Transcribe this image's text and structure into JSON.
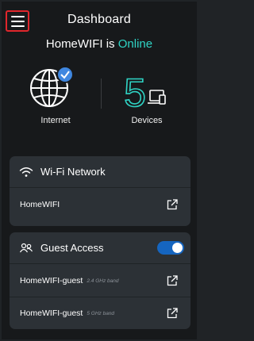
{
  "header": {
    "title": "Dashboard",
    "menu_icon": "hamburger-menu-icon"
  },
  "status": {
    "network_name": "HomeWIFI is",
    "state": "Online",
    "state_color": "#2fd4c5"
  },
  "internet": {
    "label": "Internet",
    "icon": "globe-icon",
    "badge_icon": "checkmark-badge-icon"
  },
  "devices": {
    "count": "5",
    "label": "Devices",
    "icon": "devices-icon"
  },
  "wifi_card": {
    "title": "Wi-Fi Network",
    "icon": "wifi-icon",
    "networks": [
      {
        "name": "HomeWIFI",
        "band": ""
      }
    ]
  },
  "guest_card": {
    "title": "Guest Access",
    "icon": "guests-icon",
    "toggle_on": true,
    "networks": [
      {
        "name": "HomeWIFI-guest",
        "band": "2.4 GHz band"
      },
      {
        "name": "HomeWIFI-guest",
        "band": "5 GHz band"
      }
    ]
  },
  "colors": {
    "accent": "#2fd4c5",
    "toggle": "#1565c0",
    "highlight": "#e0262c"
  }
}
